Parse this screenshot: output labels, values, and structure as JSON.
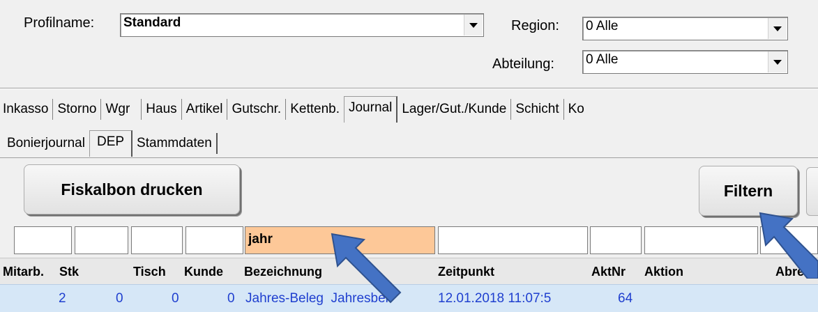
{
  "profile": {
    "label": "Profilname:",
    "value": "Standard"
  },
  "region": {
    "label": "Region:",
    "value": "0 Alle"
  },
  "abteilung": {
    "label": "Abteilung:",
    "value": "0 Alle"
  },
  "main_tabs": [
    "Inkasso",
    "Storno",
    "Wgr",
    "Haus",
    "Artikel",
    "Gutschr.",
    "Kettenb.",
    "Journal",
    "Lager/Gut./Kunde",
    "Schicht",
    "Ko"
  ],
  "active_main_tab": "Journal",
  "sub_tabs": [
    "Bonierjournal",
    "DEP",
    "Stammdaten"
  ],
  "active_sub_tab": "DEP",
  "buttons": {
    "print": "Fiskalbon drucken",
    "filter": "Filtern"
  },
  "filter": {
    "bezeichnung": "jahr"
  },
  "columns": [
    "Mitarb.",
    "Stk",
    "Tisch",
    "Kunde",
    "Bezeichnung",
    "Zeitpunkt",
    "AktNr",
    "Aktion",
    "Abre"
  ],
  "rows": [
    {
      "mitarb": "2",
      "stk": "0",
      "tisch": "0",
      "kunde": "0",
      "bezeichnung": "Jahres-Beleg  Jahresbel",
      "zeitpunkt": "12.01.2018 11:07:5",
      "aktnr": "64",
      "aktion": "",
      "abre": ""
    }
  ],
  "colors": {
    "highlight_filter": "#fdc898",
    "arrow": "#4472c4",
    "row_bg": "#d6e7f7",
    "row_text": "#1f3fcf"
  },
  "icons": [
    "dropdown-arrow-icon",
    "pointer-arrow-icon"
  ]
}
